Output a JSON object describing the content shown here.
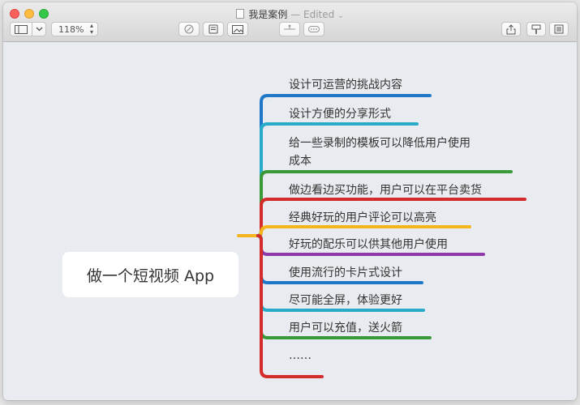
{
  "window": {
    "title": "我是案例",
    "separator": "—",
    "status": "Edited"
  },
  "toolbar": {
    "zoom": "118%",
    "buttons": [
      "sidebar-toggle-icon",
      "chevron-down-icon",
      "zoom-control",
      "check-circle-icon",
      "note-icon",
      "image-icon",
      "connect-icon",
      "more-icon",
      "share-icon",
      "format-icon",
      "outline-icon"
    ]
  },
  "mindmap": {
    "root": "做一个短视频 App",
    "colors": {
      "connector_root": "#f5b41e",
      "blue": "#1f77c9",
      "teal": "#28aac9",
      "green": "#3a9a3a",
      "red": "#d42b2b",
      "yellow": "#f2b51a",
      "purple": "#8e3aaa"
    },
    "topics": [
      {
        "line1": "设计可运营的挑战内容",
        "line2": "",
        "color": "#1f77c9"
      },
      {
        "line1": "设计方便的分享形式",
        "line2": "",
        "color": "#28aac9"
      },
      {
        "line1": "给一些录制的模板可以降低用户使用",
        "line2": "成本",
        "color": "#3a9a3a"
      },
      {
        "line1": "做边看边买功能，用户可以在平台卖货",
        "line2": "",
        "color": "#d42b2b"
      },
      {
        "line1": "经典好玩的用户评论可以高亮",
        "line2": "",
        "color": "#f2b51a"
      },
      {
        "line1": "好玩的配乐可以供其他用户使用",
        "line2": "",
        "color": "#8e3aaa"
      },
      {
        "line1": "使用流行的卡片式设计",
        "line2": "",
        "color": "#1f77c9"
      },
      {
        "line1": "尽可能全屏，体验更好",
        "line2": "",
        "color": "#28aac9"
      },
      {
        "line1": "用户可以充值，送火箭",
        "line2": "",
        "color": "#3a9a3a"
      },
      {
        "line1": "……",
        "line2": "",
        "color": "#d42b2b"
      }
    ]
  }
}
